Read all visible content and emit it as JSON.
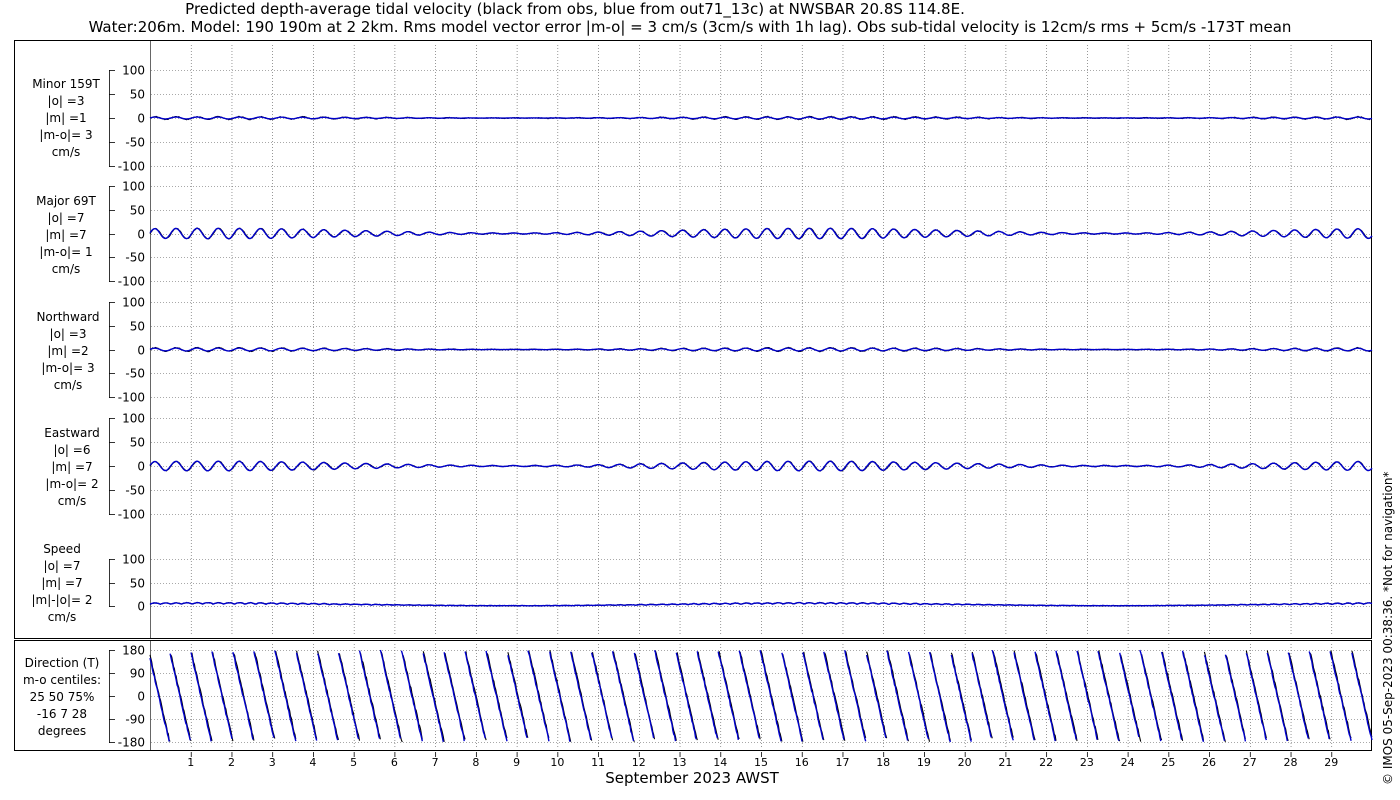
{
  "title": {
    "line1": "Predicted depth-average tidal velocity (black from obs, blue from out71_13c) at NWSBAR 20.8S 114.8E.",
    "line2": "Water:206m. Model: 190 190m at 2 2km. Rms model vector error |m-o| = 3 cm/s (3cm/s with 1h lag). Obs sub-tidal velocity is 12cm/s rms + 5cm/s -173T mean"
  },
  "copyright": "© IMOS 05-Sep-2023 00:38:36. *Not for navigation*",
  "xlabel": "September 2023 AWST",
  "colors": {
    "obs": "#000000",
    "model": "#0000cc",
    "grid": "#555555"
  },
  "chart_data": [
    {
      "type": "line",
      "panel": "minor",
      "label": [
        "Minor 159T",
        "|o| =3",
        "|m| =1",
        "|m-o|= 3",
        "cm/s"
      ],
      "ylim": [
        -100,
        100
      ],
      "yticks": [
        100,
        50,
        0,
        -50,
        -100
      ],
      "ytick_labels": [
        "100",
        "50",
        "0",
        "-50",
        "-100"
      ],
      "series": [
        {
          "color": "obs",
          "amplitude": 3
        },
        {
          "color": "model",
          "amplitude": 2
        }
      ]
    },
    {
      "type": "line",
      "panel": "major",
      "label": [
        "Major 69T",
        "|o| =7",
        "|m| =7",
        "|m-o|= 1",
        "cm/s"
      ],
      "ylim": [
        -100,
        100
      ],
      "yticks": [
        100,
        50,
        0,
        -50,
        -100
      ],
      "ytick_labels": [
        "100",
        "50",
        "0",
        "-50",
        "-100"
      ],
      "series": [
        {
          "color": "obs",
          "amplitude": 11
        },
        {
          "color": "model",
          "amplitude": 11
        }
      ]
    },
    {
      "type": "line",
      "panel": "north",
      "label": [
        "Northward",
        "|o| =3",
        "|m| =2",
        "|m-o|= 3",
        "cm/s"
      ],
      "ylim": [
        -100,
        100
      ],
      "yticks": [
        100,
        50,
        0,
        -50,
        -100
      ],
      "ytick_labels": [
        "100",
        "50",
        "0",
        "-50",
        "-100"
      ],
      "series": [
        {
          "color": "obs",
          "amplitude": 4
        },
        {
          "color": "model",
          "amplitude": 3
        }
      ]
    },
    {
      "type": "line",
      "panel": "east",
      "label": [
        "Eastward",
        "|o| =6",
        "|m| =7",
        "|m-o|= 2",
        "cm/s"
      ],
      "ylim": [
        -100,
        100
      ],
      "yticks": [
        100,
        50,
        0,
        -50,
        -100
      ],
      "ytick_labels": [
        "100",
        "50",
        "0",
        "-50",
        "-100"
      ],
      "series": [
        {
          "color": "obs",
          "amplitude": 10
        },
        {
          "color": "model",
          "amplitude": 10
        }
      ]
    },
    {
      "type": "line",
      "panel": "speed",
      "label": [
        "Speed",
        "|o| =7",
        "|m| =7",
        "|m|-|o|= 2",
        "cm/s"
      ],
      "ylim": [
        0,
        100
      ],
      "yticks": [
        100,
        50,
        0
      ],
      "ytick_labels": [
        "100",
        "50",
        "0"
      ],
      "series": [
        {
          "color": "obs",
          "amplitude": 7
        },
        {
          "color": "model",
          "amplitude": 7
        }
      ]
    },
    {
      "type": "line",
      "panel": "direction",
      "label": [
        "Direction (T)",
        "m-o centiles:",
        "25  50  75%",
        "-16   7  28",
        "degrees"
      ],
      "ylim": [
        -180,
        180
      ],
      "yticks": [
        180,
        90,
        0,
        -90,
        -180
      ],
      "ytick_labels": [
        "180",
        "90",
        "0",
        "-90",
        "-180"
      ],
      "series": [
        {
          "color": "obs"
        },
        {
          "color": "model"
        }
      ]
    }
  ],
  "x_axis": {
    "xlim": [
      0,
      30
    ],
    "ticks": [
      "1",
      "2",
      "3",
      "4",
      "5",
      "6",
      "7",
      "8",
      "9",
      "10",
      "11",
      "12",
      "13",
      "14",
      "15",
      "16",
      "17",
      "18",
      "19",
      "20",
      "21",
      "22",
      "23",
      "24",
      "25",
      "26",
      "27",
      "28",
      "29"
    ]
  }
}
